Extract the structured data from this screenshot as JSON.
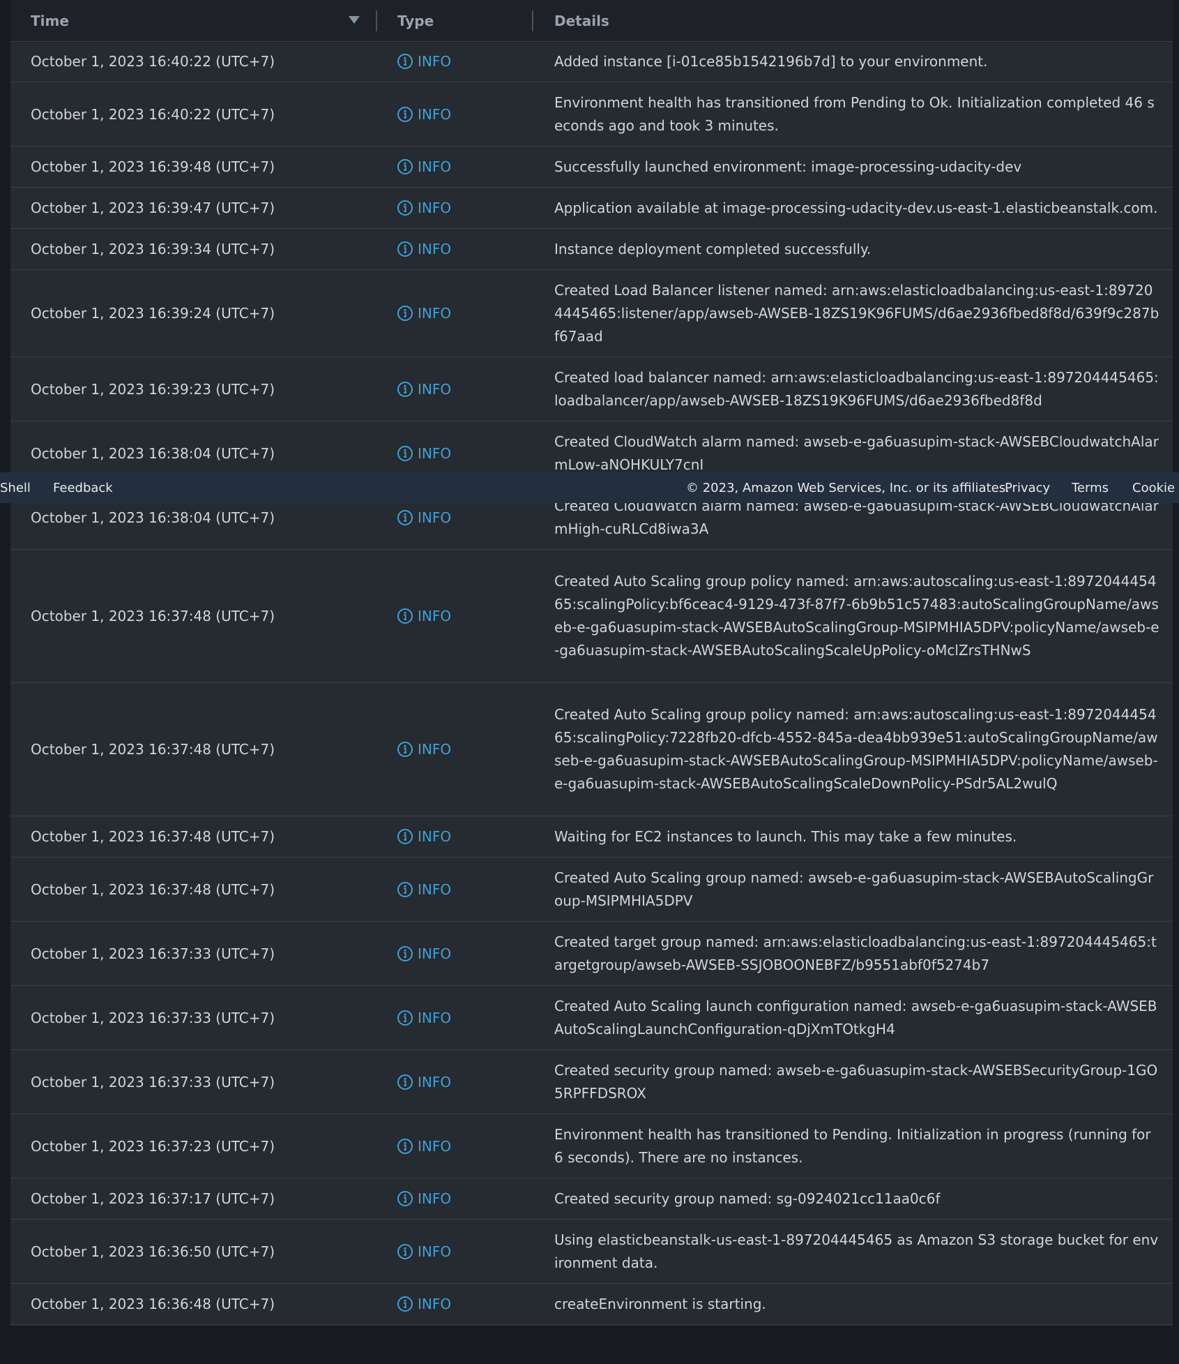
{
  "table": {
    "headers": {
      "time": "Time",
      "type": "Type",
      "details": "Details"
    },
    "rows": [
      {
        "time": "October 1, 2023 16:40:22 (UTC+7)",
        "type": "INFO",
        "details": "Added instance [i-01ce85b1542196b7d] to your environment."
      },
      {
        "time": "October 1, 2023 16:40:22 (UTC+7)",
        "type": "INFO",
        "details": "Environment health has transitioned from Pending to Ok. Initialization completed 46 seconds ago and took 3 minutes."
      },
      {
        "time": "October 1, 2023 16:39:48 (UTC+7)",
        "type": "INFO",
        "details": "Successfully launched environment: image-processing-udacity-dev"
      },
      {
        "time": "October 1, 2023 16:39:47 (UTC+7)",
        "type": "INFO",
        "details": "Application available at image-processing-udacity-dev.us-east-1.elasticbeanstalk.com."
      },
      {
        "time": "October 1, 2023 16:39:34 (UTC+7)",
        "type": "INFO",
        "details": "Instance deployment completed successfully."
      },
      {
        "time": "October 1, 2023 16:39:24 (UTC+7)",
        "type": "INFO",
        "details": "Created Load Balancer listener named: arn:aws:elasticloadbalancing:us-east-1:897204445465:listener/app/awseb-AWSEB-18ZS19K96FUMS/d6ae2936fbed8f8d/639f9c287bf67aad"
      },
      {
        "time": "October 1, 2023 16:39:23 (UTC+7)",
        "type": "INFO",
        "details": "Created load balancer named: arn:aws:elasticloadbalancing:us-east-1:897204445465:loadbalancer/app/awseb-AWSEB-18ZS19K96FUMS/d6ae2936fbed8f8d"
      },
      {
        "time": "October 1, 2023 16:38:04 (UTC+7)",
        "type": "INFO",
        "details": "Created CloudWatch alarm named: awseb-e-ga6uasupim-stack-AWSEBCloudwatchAlarmLow-aNOHKULY7cnI"
      },
      {
        "time": "October 1, 2023 16:38:04 (UTC+7)",
        "type": "INFO",
        "details": "Created CloudWatch alarm named: awseb-e-ga6uasupim-stack-AWSEBCloudwatchAlarmHigh-cuRLCd8iwa3A"
      },
      {
        "time": "October 1, 2023 16:37:48 (UTC+7)",
        "type": "INFO",
        "details": "Created Auto Scaling group policy named: arn:aws:autoscaling:us-east-1:897204445465:scalingPolicy:bf6ceac4-9129-473f-87f7-6b9b51c57483:autoScalingGroupName/awseb-e-ga6uasupim-stack-AWSEBAutoScalingGroup-MSIPMHIA5DPV:policyName/awseb-e-ga6uasupim-stack-AWSEBAutoScalingScaleUpPolicy-oMclZrsTHNwS"
      },
      {
        "time": "October 1, 2023 16:37:48 (UTC+7)",
        "type": "INFO",
        "details": "Created Auto Scaling group policy named: arn:aws:autoscaling:us-east-1:897204445465:scalingPolicy:7228fb20-dfcb-4552-845a-dea4bb939e51:autoScalingGroupName/awseb-e-ga6uasupim-stack-AWSEBAutoScalingGroup-MSIPMHIA5DPV:policyName/awseb-e-ga6uasupim-stack-AWSEBAutoScalingScaleDownPolicy-PSdr5AL2wulQ"
      },
      {
        "time": "October 1, 2023 16:37:48 (UTC+7)",
        "type": "INFO",
        "details": "Waiting for EC2 instances to launch. This may take a few minutes."
      },
      {
        "time": "October 1, 2023 16:37:48 (UTC+7)",
        "type": "INFO",
        "details": "Created Auto Scaling group named: awseb-e-ga6uasupim-stack-AWSEBAutoScalingGroup-MSIPMHIA5DPV"
      },
      {
        "time": "October 1, 2023 16:37:33 (UTC+7)",
        "type": "INFO",
        "details": "Created target group named: arn:aws:elasticloadbalancing:us-east-1:897204445465:targetgroup/awseb-AWSEB-SSJOBOONEBFZ/b9551abf0f5274b7"
      },
      {
        "time": "October 1, 2023 16:37:33 (UTC+7)",
        "type": "INFO",
        "details": "Created Auto Scaling launch configuration named: awseb-e-ga6uasupim-stack-AWSEBAutoScalingLaunchConfiguration-qDjXmTOtkgH4"
      },
      {
        "time": "October 1, 2023 16:37:33 (UTC+7)",
        "type": "INFO",
        "details": "Created security group named: awseb-e-ga6uasupim-stack-AWSEBSecurityGroup-1GO5RPFFDSROX"
      },
      {
        "time": "October 1, 2023 16:37:23 (UTC+7)",
        "type": "INFO",
        "details": "Environment health has transitioned to Pending. Initialization in progress (running for 6 seconds). There are no instances."
      },
      {
        "time": "October 1, 2023 16:37:17 (UTC+7)",
        "type": "INFO",
        "details": "Created security group named: sg-0924021cc11aa0c6f"
      },
      {
        "time": "October 1, 2023 16:36:50 (UTC+7)",
        "type": "INFO",
        "details": "Using elasticbeanstalk-us-east-1-897204445465 as Amazon S3 storage bucket for environment data."
      },
      {
        "time": "October 1, 2023 16:36:48 (UTC+7)",
        "type": "INFO",
        "details": "createEnvironment is starting."
      }
    ]
  },
  "footer": {
    "shell": "Shell",
    "feedback": "Feedback",
    "copyright": "© 2023, Amazon Web Services, Inc. or its affiliates.",
    "privacy": "Privacy",
    "terms": "Terms",
    "cookie": "Cookie p"
  },
  "colors": {
    "info_accent": "#3ea1d6",
    "footer_bg": "#232f3e",
    "panel_bg": "#262a31"
  },
  "icons": {
    "type_icon": "info-circle-icon"
  }
}
